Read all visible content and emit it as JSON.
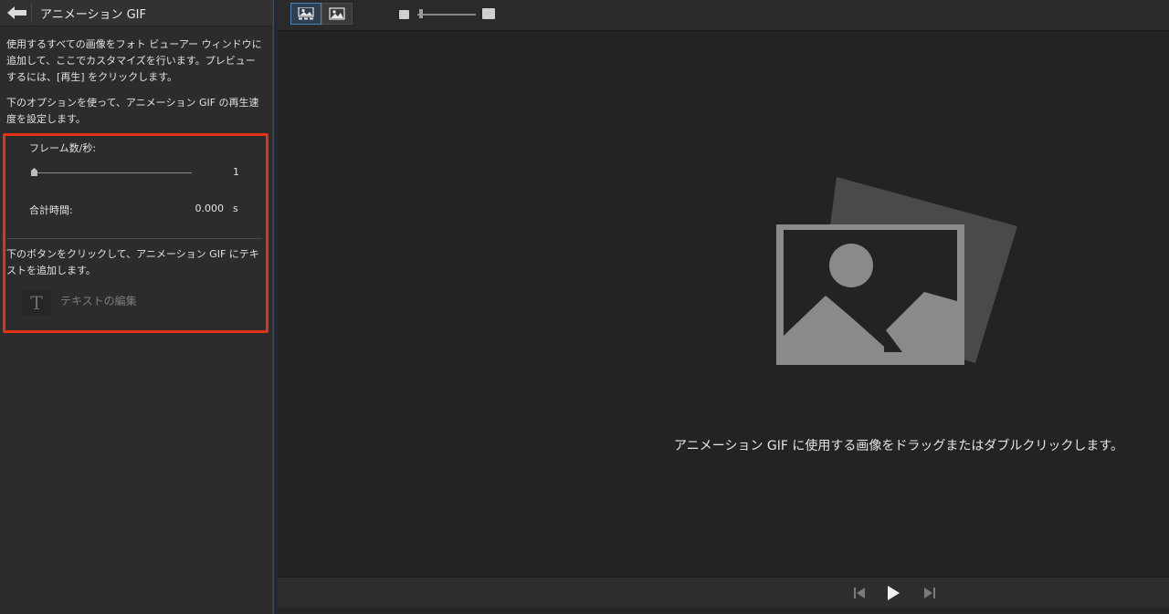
{
  "panel": {
    "title": "アニメーション GIF",
    "description1": "使用するすべての画像をフォト ビューアー ウィンドウに追加して、ここでカスタマイズを行います。プレビューするには、[再生] をクリックします。",
    "description2": "下のオプションを使って、アニメーション GIF の再生速度を設定します。",
    "fps_label": "フレーム数/秒:",
    "fps_value": "1",
    "fps_level": 0,
    "total_time_label": "合計時間:",
    "total_time_value": "0.000",
    "total_time_unit": "s",
    "description3": "下のボタンをクリックして、アニメーション GIF にテキストを追加します。",
    "text_icon_glyph": "T",
    "edit_text_label": "テキストの編集"
  },
  "main": {
    "drop_hint": "アニメーション GIF に使用する画像をドラッグまたはダブルクリックします。"
  },
  "colors": {
    "highlight": "#e03418",
    "accent": "#4d7fb8"
  },
  "icons": {
    "back": "back-arrow-icon",
    "grid_view": "thumbnail-grid-icon",
    "single_view": "single-image-icon",
    "placeholder": "photo-placeholder-icon",
    "prev": "skip-previous-icon",
    "play": "play-icon",
    "next": "skip-next-icon"
  }
}
